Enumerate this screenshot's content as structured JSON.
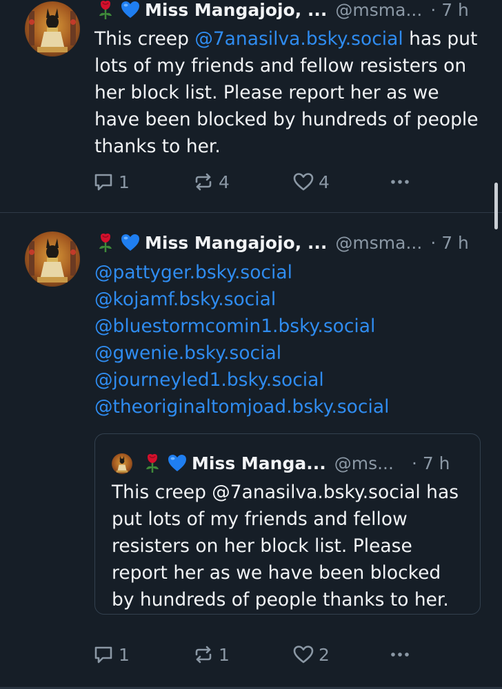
{
  "posts": [
    {
      "author_name": "Miss Mangajojo, ...",
      "author_handle": "@msma...",
      "time": "· 7 h",
      "text": {
        "before": "This creep ",
        "mention": "@7anasilva.bsky.social",
        "after": " has put lots of my friends and fellow resisters on her block list. Please report her as we have been blocked by hundreds of people thanks to her."
      },
      "stats": {
        "replies": "1",
        "reposts": "4",
        "likes": "4"
      }
    },
    {
      "author_name": "Miss Mangajojo, ...",
      "author_handle": "@msma...",
      "time": "· 7 h",
      "mentions": [
        "@pattyger.bsky.social",
        "@kojamf.bsky.social",
        "@bluestormcomin1.bsky.social",
        "@gwenie.bsky.social",
        "@journeyled1.bsky.social",
        "@theoriginaltomjoad.bsky.social"
      ],
      "quote": {
        "author_name": "Miss Manga...",
        "author_handle": "@ms...",
        "time": "· 7 h",
        "text": "This creep @7anasilva.bsky.social has put lots of my friends and fellow resisters on her block list. Please report her as we have been blocked by hundreds of people thanks to her."
      },
      "stats": {
        "replies": "1",
        "reposts": "1",
        "likes": "2"
      }
    }
  ],
  "icons": {
    "name_emojis": [
      "rose-emoji",
      "blue-heart-emoji"
    ],
    "actions": [
      "reply-icon",
      "repost-icon",
      "like-icon",
      "more-icon"
    ]
  },
  "colors": {
    "background": "#161e27",
    "link": "#2f8cf0",
    "muted": "#8b98a5",
    "text": "#f1f3f5"
  }
}
